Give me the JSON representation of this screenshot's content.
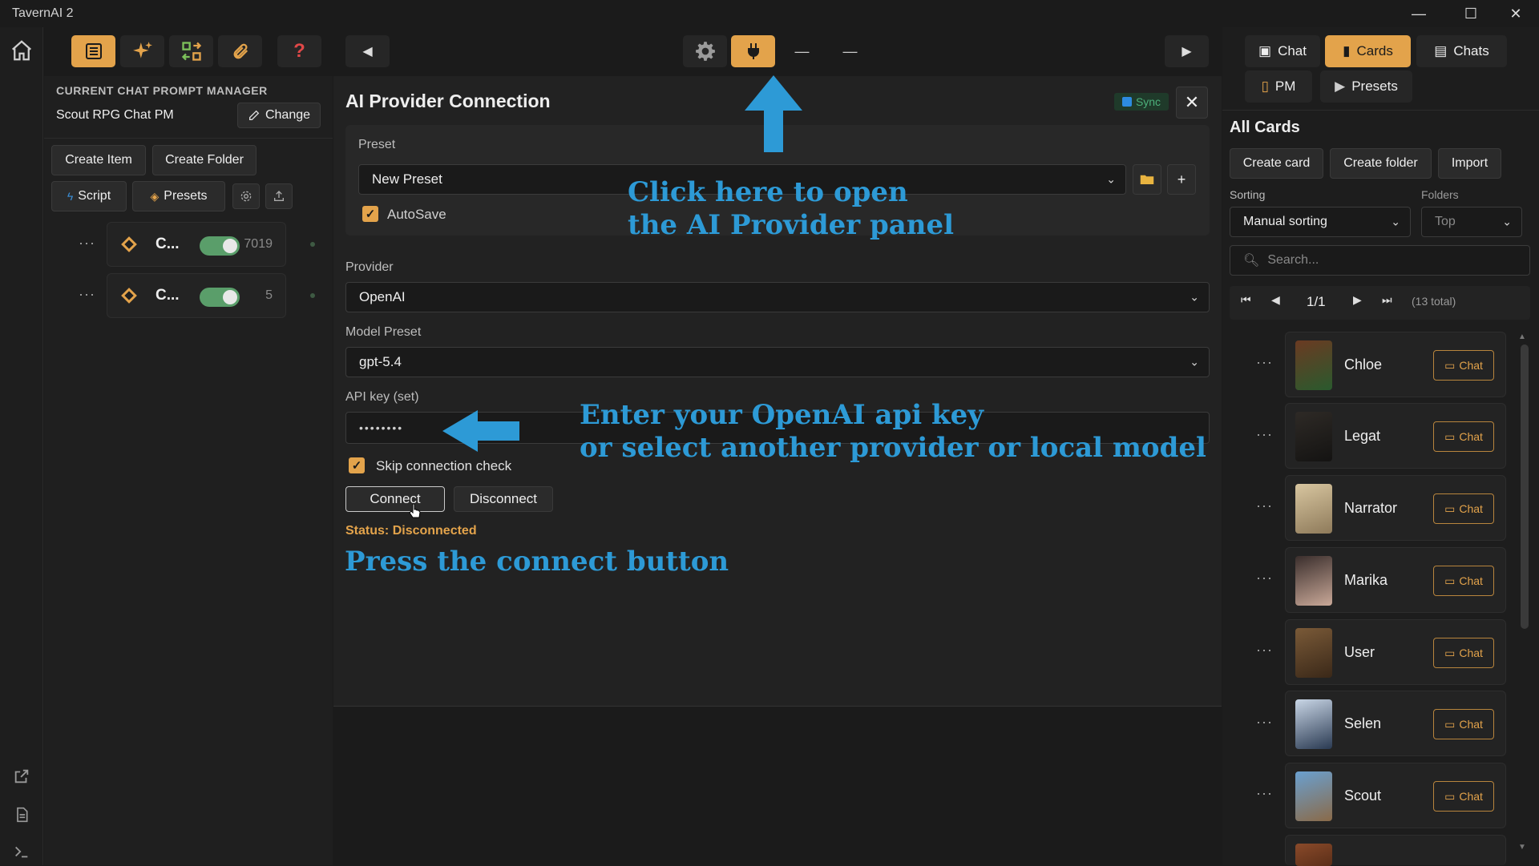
{
  "window": {
    "title": "TavernAI 2"
  },
  "left_panel": {
    "header": "CURRENT CHAT PROMPT MANAGER",
    "pm_name": "Scout RPG Chat PM",
    "change_label": "Change",
    "create_item_label": "Create Item",
    "create_folder_label": "Create Folder",
    "script_label": "Script",
    "presets_label": "Presets",
    "items": [
      {
        "label": "C...",
        "count": "7019",
        "enabled": true
      },
      {
        "label": "C...",
        "count": "5",
        "enabled": true
      }
    ]
  },
  "toolbar": {
    "minus1": "—",
    "minus2": "—"
  },
  "provider_panel": {
    "title": "AI Provider Connection",
    "sync_label": "Sync",
    "preset_label": "Preset",
    "preset_value": "New Preset",
    "autosave_label": "AutoSave",
    "provider_label": "Provider",
    "provider_value": "OpenAI",
    "model_label": "Model Preset",
    "model_value": "gpt-5.4",
    "apikey_label": "API key (set)",
    "apikey_value": "••••••••",
    "skip_check_label": "Skip connection check",
    "connect_label": "Connect",
    "disconnect_label": "Disconnect",
    "status_prefix": "Status:",
    "status_value": "Disconnected"
  },
  "annotations": {
    "open_panel_line1": "Click here to open",
    "open_panel_line2": "the AI Provider panel",
    "api_key_line1": "Enter your OpenAI api key",
    "api_key_line2": "or select another provider or local model",
    "connect_hint": "Press the connect button"
  },
  "right_panel": {
    "tabs": {
      "chat": "Chat",
      "cards": "Cards",
      "chats": "Chats",
      "pm": "PM",
      "presets": "Presets"
    },
    "title": "All Cards",
    "create_card_label": "Create card",
    "create_folder_label": "Create folder",
    "import_label": "Import",
    "sorting_label": "Sorting",
    "sorting_value": "Manual sorting",
    "folders_label": "Folders",
    "folders_value": "Top",
    "search_placeholder": "Search...",
    "page_indicator": "1/1",
    "total": "(13 total)",
    "cards": [
      {
        "name": "Chloe",
        "chat_label": "Chat"
      },
      {
        "name": "Legat",
        "chat_label": "Chat"
      },
      {
        "name": "Narrator",
        "chat_label": "Chat"
      },
      {
        "name": "Marika",
        "chat_label": "Chat"
      },
      {
        "name": "User",
        "chat_label": "Chat"
      },
      {
        "name": "Selen",
        "chat_label": "Chat"
      },
      {
        "name": "Scout",
        "chat_label": "Chat"
      }
    ]
  },
  "colors": {
    "accent": "#e3a34b",
    "annotation": "#2d9ad6",
    "status_warn": "#e3a34b",
    "toggle_on": "#5a9e6a"
  }
}
